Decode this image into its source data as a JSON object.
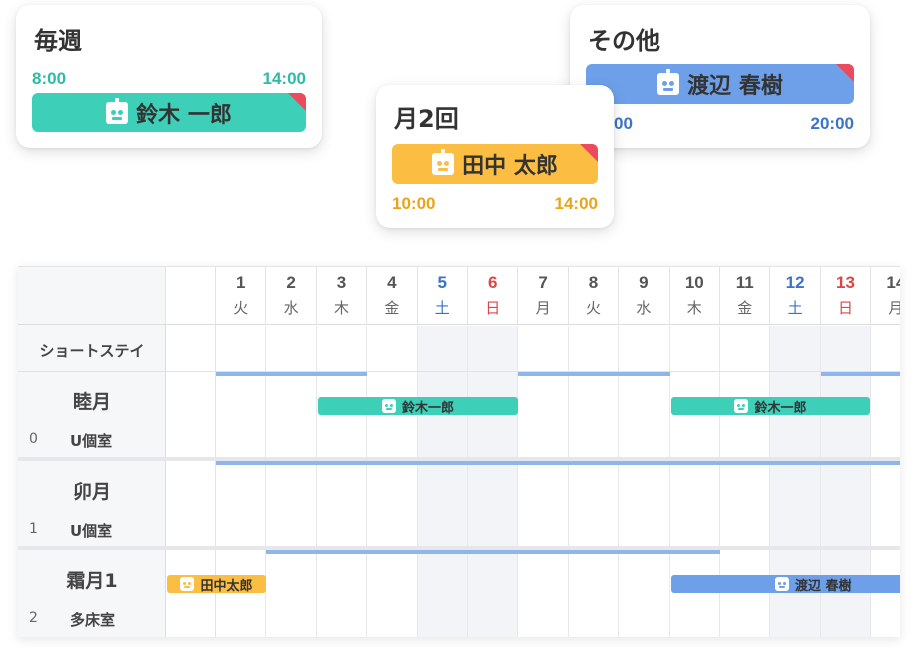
{
  "colors": {
    "teal": "#3ecfb9",
    "yellow": "#fbbd42",
    "blue": "#6da0e8",
    "corner_red": "#ec4a5d",
    "saturday": "#3b73c9",
    "sunday": "#d84848",
    "stripe": "#8fb6ec"
  },
  "cards": {
    "weekly": {
      "title": "毎週",
      "start": "8:00",
      "end": "14:00",
      "person": "鈴木 一郎",
      "icon": "robot-icon"
    },
    "monthly": {
      "title": "月2回",
      "start": "10:00",
      "end": "14:00",
      "person": "田中 太郎",
      "icon": "robot-icon"
    },
    "other": {
      "title": "その他",
      "start": "00",
      "end": "20:00",
      "person": "渡辺 春樹",
      "icon": "robot-icon"
    }
  },
  "calendar": {
    "days": [
      {
        "d": "1",
        "w": "火"
      },
      {
        "d": "2",
        "w": "水"
      },
      {
        "d": "3",
        "w": "木"
      },
      {
        "d": "4",
        "w": "金"
      },
      {
        "d": "5",
        "w": "土"
      },
      {
        "d": "6",
        "w": "日"
      },
      {
        "d": "7",
        "w": "月"
      },
      {
        "d": "8",
        "w": "火"
      },
      {
        "d": "9",
        "w": "水"
      },
      {
        "d": "10",
        "w": "木"
      },
      {
        "d": "11",
        "w": "金"
      },
      {
        "d": "12",
        "w": "土"
      },
      {
        "d": "13",
        "w": "日"
      },
      {
        "d": "14",
        "w": "月"
      }
    ],
    "category": "ショートステイ",
    "rooms": [
      {
        "name": "睦月",
        "num": "0",
        "type": "U個室"
      },
      {
        "name": "卯月",
        "num": "1",
        "type": "U個室"
      },
      {
        "name": "霜月1",
        "num": "2",
        "type": "多床室"
      }
    ],
    "events": [
      {
        "label": "鈴木一郎",
        "icon": "robot-icon"
      },
      {
        "label": "鈴木一郎",
        "icon": "robot-icon"
      },
      {
        "label": "田中太郎",
        "icon": "robot-icon"
      },
      {
        "label": "渡辺 春樹",
        "icon": "robot-icon"
      }
    ]
  }
}
